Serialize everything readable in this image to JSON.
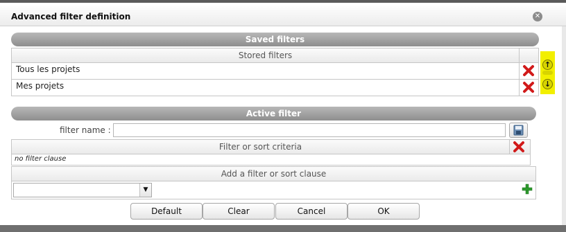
{
  "dialog": {
    "title": "Advanced filter definition",
    "close_icon": "close-circle-icon"
  },
  "saved": {
    "section_title": "Saved filters",
    "column_header": "Stored filters",
    "rows": [
      {
        "label": "Tous les projets"
      },
      {
        "label": "Mes projets"
      }
    ],
    "delete_icon": "red-x-icon",
    "move_up_icon": "arrow-up-icon",
    "move_down_icon": "arrow-down-icon",
    "highlight_color": "#f2ef00"
  },
  "active": {
    "section_title": "Active filter",
    "filter_name_label": "filter name :",
    "filter_name_value": "",
    "save_icon": "floppy-disk-icon",
    "criteria_header": "Filter or sort criteria",
    "no_clause_text": "no filter clause",
    "add_clause_header": "Add a filter or sort clause",
    "clause_select_value": "",
    "add_icon": "green-plus-icon"
  },
  "buttons": {
    "default": "Default",
    "clear": "Clear",
    "cancel": "Cancel",
    "ok": "OK"
  }
}
